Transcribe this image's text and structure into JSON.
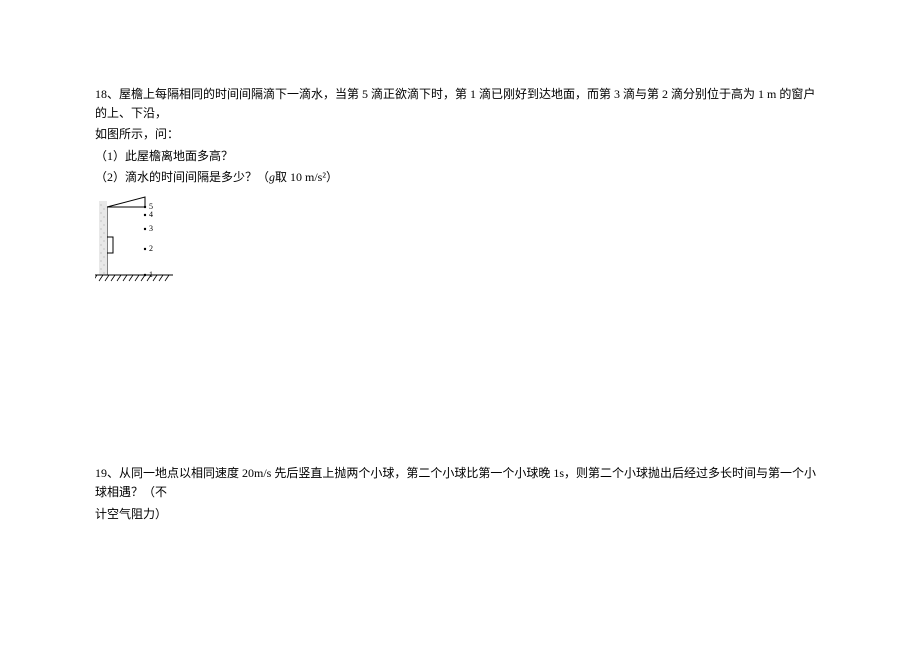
{
  "problems": {
    "p18": {
      "number": "18",
      "main_text_1": "、屋檐上每隔相同的时间间隔滴下一滴水，当第 5 滴正欲滴下时，第 1 滴已刚好到达地面，而第 3 滴与第 2 滴分别位于高为 1 m 的窗户的上、下沿，",
      "main_text_2": "如图所示，问：",
      "q1": "（1）此屋檐离地面多高？",
      "q2_prefix": "（2）滴水的时间间隔是多少？（",
      "q2_g": "g",
      "q2_suffix": "取 10 m/s²）",
      "drop_labels": [
        "5",
        "4",
        "3",
        "2",
        "1"
      ]
    },
    "p19": {
      "number": "19",
      "main_text_1": "、从同一地点以相同速度 20m/s 先后竖直上抛两个小球，第二个小球比第一个小球晚 1s，则第二个小球抛出后经过多长时间与第一个小球相遇？（不",
      "main_text_2": "计空气阻力）"
    }
  }
}
